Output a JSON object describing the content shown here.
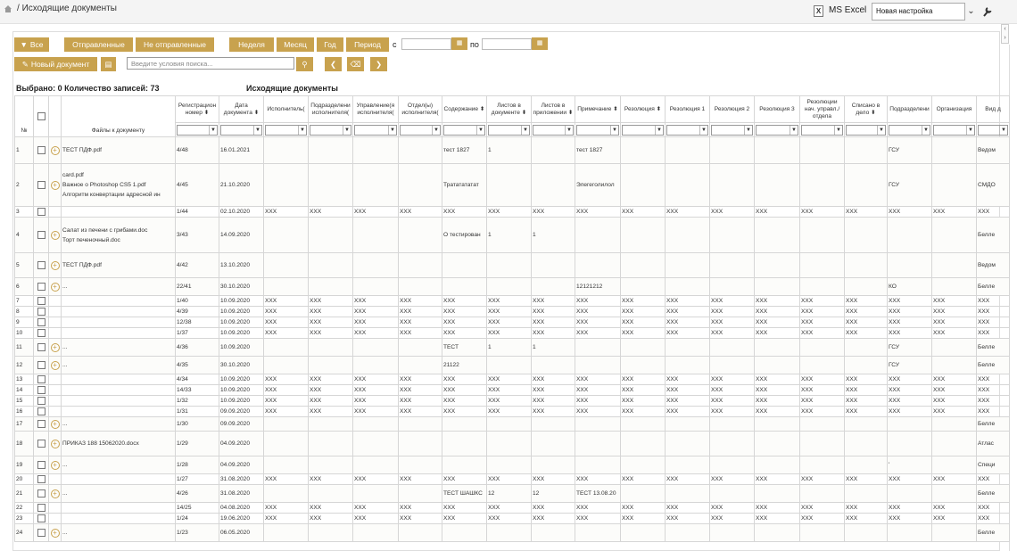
{
  "page": {
    "breadcrumb_sep": "/",
    "title": "Исходящие документы"
  },
  "header": {
    "excel_label": "MS Excel",
    "preset_value": "Новая настройка",
    "icons": [
      "home-icon",
      "excel-icon",
      "chevron-down-icon",
      "wrench-icon"
    ]
  },
  "filters": {
    "all_label": "Все",
    "sent_label": "Отправленные",
    "not_sent_label": "Не отправленные",
    "week_label": "Неделя",
    "month_label": "Месяц",
    "year_label": "Год",
    "period_label": "Период",
    "from_label": "с",
    "to_label": "по"
  },
  "toolbar": {
    "new_doc_label": "Новый документ",
    "search_placeholder": "Введите условия поиска..."
  },
  "summary": {
    "text": "Выбрано: 0 Количество записей: 73",
    "caption": "Исходящие документы"
  },
  "columns": [
    {
      "key": "num",
      "label": "№"
    },
    {
      "key": "cb",
      "label": ""
    },
    {
      "key": "plus",
      "label": ""
    },
    {
      "key": "files",
      "label": "Файлы к документу"
    },
    {
      "key": "reg",
      "label": "Регистрацион номер ⬍"
    },
    {
      "key": "date",
      "label": "Дата документа ⬍"
    },
    {
      "key": "exec",
      "label": "Исполнитель("
    },
    {
      "key": "podr",
      "label": "Подразделени исполнителя("
    },
    {
      "key": "upr",
      "label": "Управление(я исполнителя("
    },
    {
      "key": "otd",
      "label": "Отдел(ы) исполнителя("
    },
    {
      "key": "cont",
      "label": "Содержание ⬍"
    },
    {
      "key": "lists",
      "label": "Листов в документе ⬍"
    },
    {
      "key": "app",
      "label": "Листов в приложении ⬍"
    },
    {
      "key": "note",
      "label": "Примечание ⬍"
    },
    {
      "key": "res",
      "label": "Резолюция ⬍"
    },
    {
      "key": "res1",
      "label": "Резолюция 1"
    },
    {
      "key": "res2",
      "label": "Резолюция 2"
    },
    {
      "key": "res3",
      "label": "Резолюция 3"
    },
    {
      "key": "resn",
      "label": "Резолюции нач. управл./отдела"
    },
    {
      "key": "case",
      "label": "Списано в дело ⬍"
    },
    {
      "key": "dept",
      "label": "Подразделени"
    },
    {
      "key": "org",
      "label": "Организация"
    },
    {
      "key": "kind",
      "label": "Вид д"
    }
  ],
  "rows": [
    {
      "n": "1",
      "plus": true,
      "files": [
        "ТЕСТ ПДФ.pdf"
      ],
      "reg": "4/48",
      "date": "16.01.2021",
      "cont": "тест 1827",
      "lists": "1",
      "note": "тест 1827",
      "dept": "ГСУ",
      "kind": "Ведом",
      "h": 30
    },
    {
      "n": "2",
      "plus": true,
      "files": [
        "card.pdf",
        "Важное о Photoshop CS5 1.pdf",
        "Алгоритм конвертации адресной ин"
      ],
      "reg": "4/45",
      "date": "21.10.2020",
      "cont": "Трататататат",
      "note": "Элегеголилол",
      "dept": "ГСУ",
      "kind": "СМДО",
      "h": 48
    },
    {
      "n": "3",
      "xxx": true,
      "reg": "1/44",
      "date": "02.10.2020",
      "h": 12
    },
    {
      "n": "4",
      "plus": true,
      "files": [
        "Салат из печени с грибами.doc",
        "Торт печеночный.doc"
      ],
      "reg": "3/43",
      "date": "14.09.2020",
      "cont": "О тестирован",
      "lists": "1",
      "app": "1",
      "kind": "Белле",
      "h": 40
    },
    {
      "n": "5",
      "plus": true,
      "files": [
        "ТЕСТ ПДФ.pdf"
      ],
      "reg": "4/42",
      "date": "13.10.2020",
      "kind": "Ведом",
      "h": 28
    },
    {
      "n": "6",
      "plus": true,
      "dots": true,
      "reg": "22/41",
      "date": "30.10.2020",
      "note": "12121212",
      "dept": "КО",
      "kind": "Белле",
      "h": 20
    },
    {
      "n": "7",
      "xxx": true,
      "reg": "1/40",
      "date": "10.09.2020",
      "h": 12
    },
    {
      "n": "8",
      "xxx": true,
      "reg": "4/39",
      "date": "10.09.2020",
      "h": 12
    },
    {
      "n": "9",
      "xxx": true,
      "reg": "12/38",
      "date": "10.09.2020",
      "h": 12
    },
    {
      "n": "10",
      "xxx": true,
      "reg": "1/37",
      "date": "10.09.2020",
      "h": 12
    },
    {
      "n": "11",
      "plus": true,
      "dots": true,
      "reg": "4/36",
      "date": "10.09.2020",
      "cont": "ТЕСТ",
      "lists": "1",
      "app": "1",
      "dept": "ГСУ",
      "kind": "Белле",
      "h": 20
    },
    {
      "n": "12",
      "plus": true,
      "dots": true,
      "reg": "4/35",
      "date": "30.10.2020",
      "cont": "21122",
      "dept": "ГСУ",
      "kind": "Белле",
      "h": 20
    },
    {
      "n": "13",
      "xxx": true,
      "reg": "4/34",
      "date": "10.09.2020",
      "h": 12
    },
    {
      "n": "14",
      "xxx": true,
      "reg": "14/33",
      "date": "10.09.2020",
      "h": 12
    },
    {
      "n": "15",
      "xxx": true,
      "reg": "1/32",
      "date": "10.09.2020",
      "h": 12
    },
    {
      "n": "16",
      "xxx": true,
      "reg": "1/31",
      "date": "09.09.2020",
      "h": 12
    },
    {
      "n": "17",
      "plus": true,
      "dots": true,
      "reg": "1/30",
      "date": "09.09.2020",
      "kind": "Белле",
      "h": 16
    },
    {
      "n": "18",
      "plus": true,
      "files": [
        "ПРИКАЗ 188 15062020.docx"
      ],
      "reg": "1/29",
      "date": "04.09.2020",
      "kind": "Атлас",
      "h": 28
    },
    {
      "n": "19",
      "plus": true,
      "dots": true,
      "reg": "1/28",
      "date": "04.09.2020",
      "dept": "'",
      "kind": "Специ",
      "h": 20
    },
    {
      "n": "20",
      "xxx": true,
      "reg": "1/27",
      "date": "31.08.2020",
      "h": 12
    },
    {
      "n": "21",
      "plus": true,
      "dots": true,
      "reg": "4/26",
      "date": "31.08.2020",
      "cont": "ТЕСТ ШАШКС",
      "lists": "12",
      "app": "12",
      "note": "ТЕСТ 13.08.20",
      "kind": "Белле",
      "h": 20
    },
    {
      "n": "22",
      "xxx": true,
      "reg": "14/25",
      "date": "04.08.2020",
      "h": 12
    },
    {
      "n": "23",
      "xxx": true,
      "reg": "1/24",
      "date": "19.06.2020",
      "h": 12
    },
    {
      "n": "24",
      "plus": true,
      "dots": true,
      "reg": "1/23",
      "date": "06.05.2020",
      "kind": "Белле",
      "h": 20
    }
  ],
  "xxx_value": "XXX",
  "dots_value": "...",
  "colors": {
    "accent": "#c8a24e",
    "border": "#d6d6d6"
  }
}
